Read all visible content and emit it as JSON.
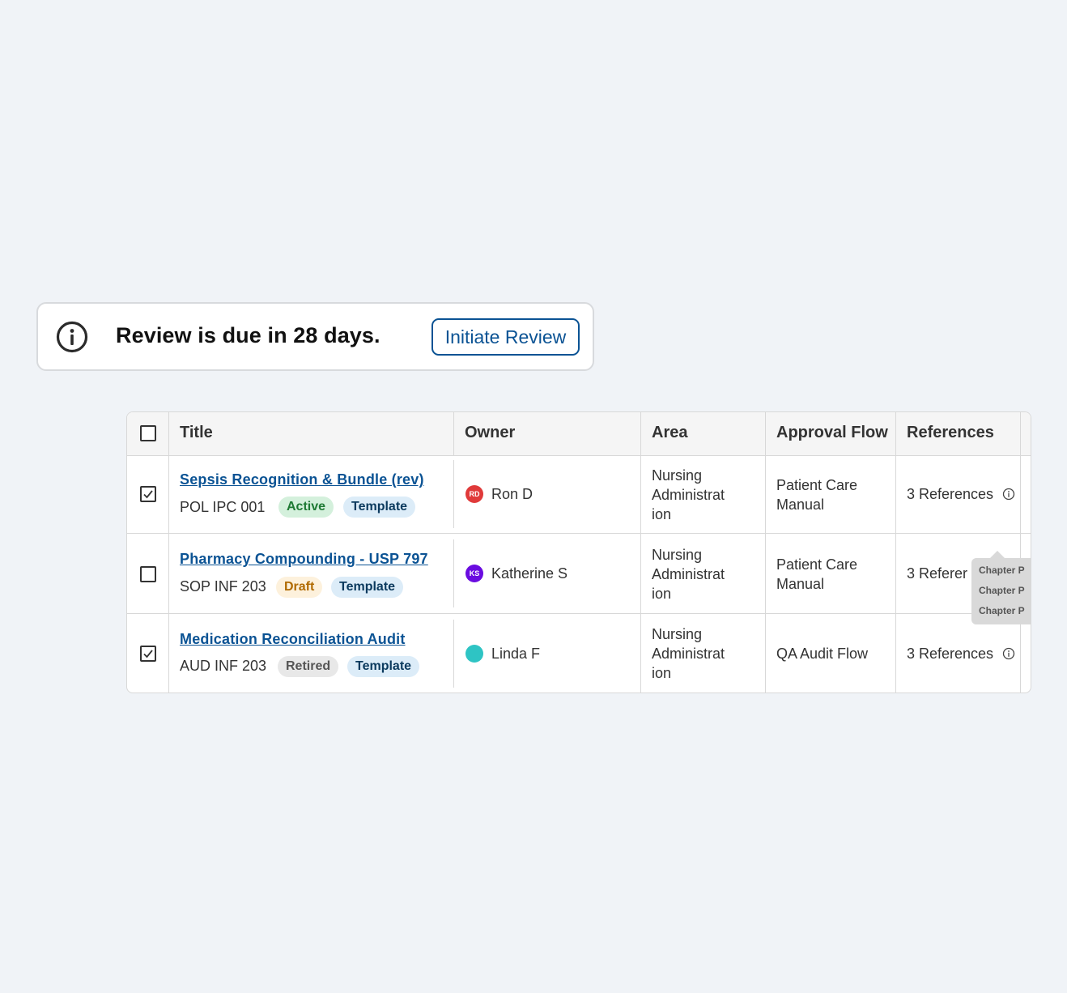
{
  "banner": {
    "message": "Review is due in 28 days.",
    "button_label": "Initiate Review",
    "icon": "info-circle-icon"
  },
  "table": {
    "headers": {
      "title": "Title",
      "owner": "Owner",
      "area": "Area",
      "approval_flow": "Approval Flow",
      "references": "References"
    },
    "rows": [
      {
        "checked": true,
        "title": "Sepsis Recognition & Bundle (rev)",
        "code": "POL IPC 001",
        "status": "Active",
        "type_badge": "Template",
        "owner_initials": "RD",
        "owner_name": "Ron D",
        "area_lines": [
          "Nursing",
          "Administrat",
          "ion"
        ],
        "flow_lines": [
          "Patient Care",
          "Manual"
        ],
        "references": "3 References"
      },
      {
        "checked": false,
        "title": "Pharmacy Compounding - USP 797",
        "code": "SOP INF 203",
        "status": "Draft",
        "type_badge": "Template",
        "owner_initials": "KS",
        "owner_name": "Katherine S",
        "area_lines": [
          "Nursing",
          "Administrat",
          "ion"
        ],
        "flow_lines": [
          "Patient Care",
          "Manual"
        ],
        "references": "3 Referer"
      },
      {
        "checked": true,
        "title": "Medication Reconciliation Audit",
        "code": "AUD INF 203",
        "status": "Retired",
        "type_badge": "Template",
        "owner_initials": "",
        "owner_name": "Linda F",
        "area_lines": [
          "Nursing",
          "Administrat",
          "ion"
        ],
        "flow_lines": [
          "QA Audit Flow"
        ],
        "references": "3 References"
      }
    ],
    "tooltip_items": [
      "Chapter P",
      "Chapter P",
      "Chapter P"
    ]
  },
  "colors": {
    "link": "#0b5394",
    "active_bg": "#d4f0dc",
    "active_text": "#1e7a34",
    "draft_bg": "#fdf1dc",
    "draft_text": "#b06a00",
    "retired_bg": "#e8e8e8",
    "retired_text": "#555555",
    "template_bg": "#dcecf8",
    "template_text": "#0b3a5e",
    "avatar_rd": "#e03a3a",
    "avatar_ks": "#6a0ce0",
    "avatar_lf": "#2ec4c4"
  }
}
